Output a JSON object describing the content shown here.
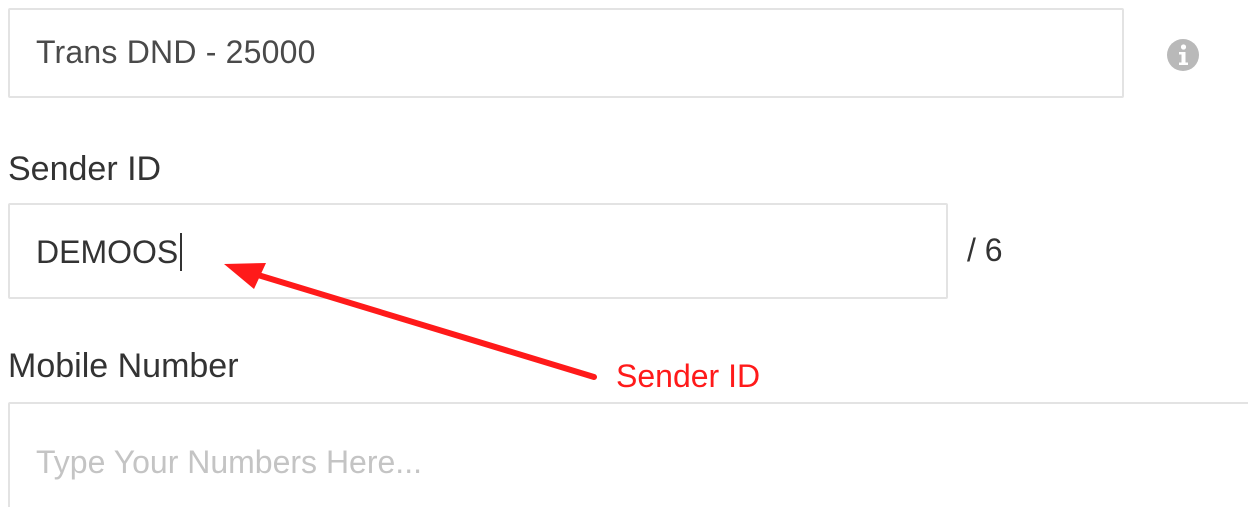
{
  "route_field": {
    "value": "Trans DND - 25000",
    "icon": "info-icon"
  },
  "sender": {
    "label": "Sender ID",
    "value": "DEMOOS",
    "counter": "/ 6"
  },
  "mobile": {
    "label": "Mobile Number",
    "placeholder": "Type Your Numbers Here..."
  },
  "annotation": {
    "label": "Sender ID",
    "color": "#ff1a1a"
  }
}
